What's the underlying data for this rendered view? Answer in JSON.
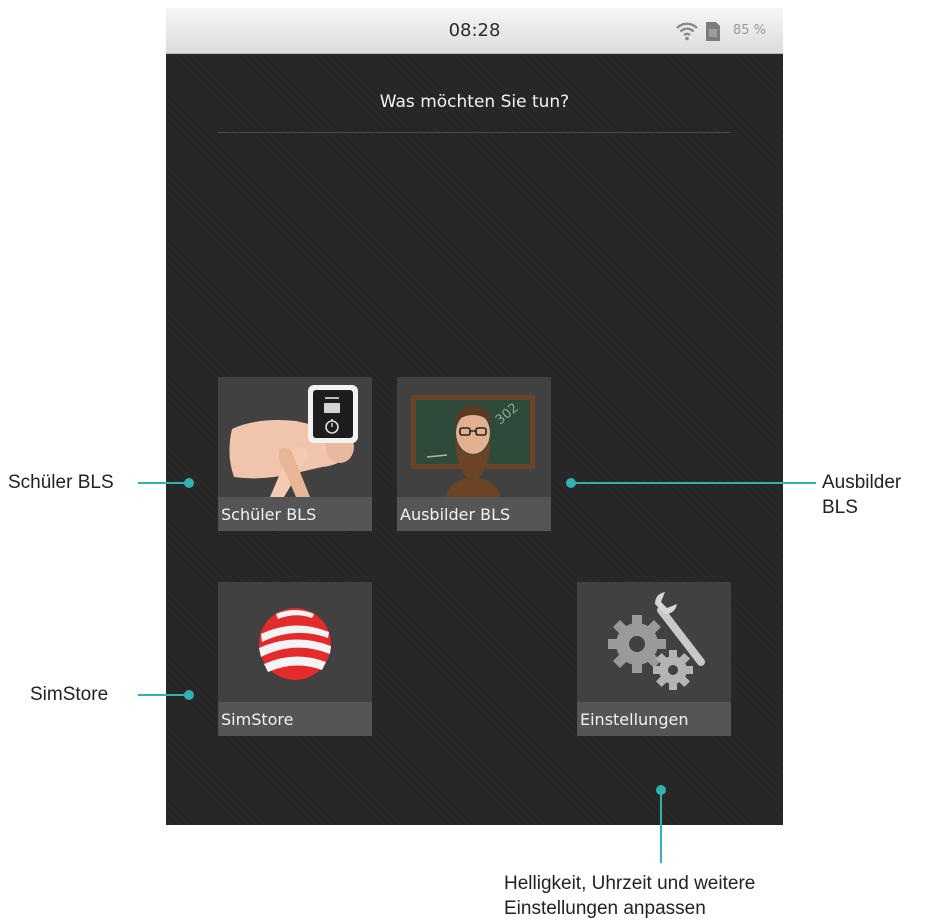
{
  "status_bar": {
    "time": "08:28",
    "battery_percent": "85 %",
    "icons": [
      "wifi-icon",
      "sim-card-icon"
    ]
  },
  "screen": {
    "heading": "Was möchten Sie tun?"
  },
  "tiles": [
    {
      "label": "Schüler BLS",
      "icon": "cpr-manikin-icon"
    },
    {
      "label": "Ausbilder BLS",
      "icon": "instructor-chalkboard-icon"
    },
    {
      "label": "SimStore",
      "icon": "simstore-globe-icon"
    },
    {
      "label": "Einstellungen",
      "icon": "gears-wrench-icon"
    }
  ],
  "annotations": {
    "schueler": "Schüler BLS",
    "ausbilder_line1": "Ausbilder",
    "ausbilder_line2": "BLS",
    "simstore": "SimStore",
    "einstellungen_line1": "Helligkeit, Uhrzeit und weitere",
    "einstellungen_line2": "Einstellungen anpassen"
  },
  "colors": {
    "accent": "#2fb2b0",
    "screen_bg": "#262626",
    "tile_bg": "#414141"
  }
}
